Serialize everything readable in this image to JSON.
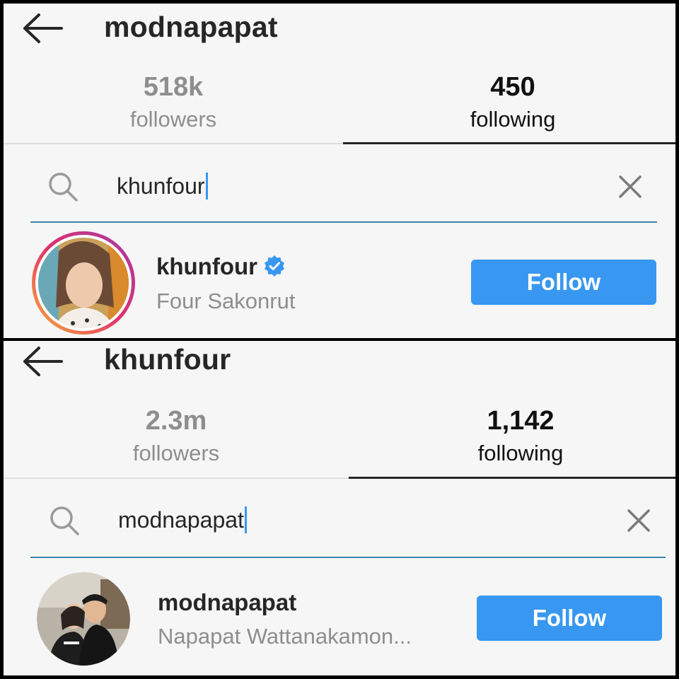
{
  "panels": [
    {
      "header": {
        "title": "modnapapat",
        "back_icon": "arrow-left-icon"
      },
      "stats": {
        "followers": {
          "count": "518k",
          "label": "followers"
        },
        "following": {
          "count": "450",
          "label": "following"
        },
        "active_tab": "following"
      },
      "search": {
        "value": "khunfour",
        "icon": "search-icon",
        "clear_icon": "close-icon"
      },
      "result": {
        "username": "khunfour",
        "verified": true,
        "full_name": "Four Sakonrut",
        "follow_label": "Follow",
        "has_story_ring": true
      }
    },
    {
      "header": {
        "title": "khunfour",
        "back_icon": "arrow-left-icon"
      },
      "stats": {
        "followers": {
          "count": "2.3m",
          "label": "followers"
        },
        "following": {
          "count": "1,142",
          "label": "following"
        },
        "active_tab": "following"
      },
      "search": {
        "value": "modnapapat",
        "icon": "search-icon",
        "clear_icon": "close-icon"
      },
      "result": {
        "username": "modnapapat",
        "verified": false,
        "full_name": "Napapat Wattanakamon...",
        "follow_label": "Follow",
        "has_story_ring": false
      }
    }
  ],
  "colors": {
    "follow_button": "#3897f0",
    "search_underline": "#3d86a8",
    "verified_badge": "#3897f0",
    "background": "#f6f6f6"
  }
}
